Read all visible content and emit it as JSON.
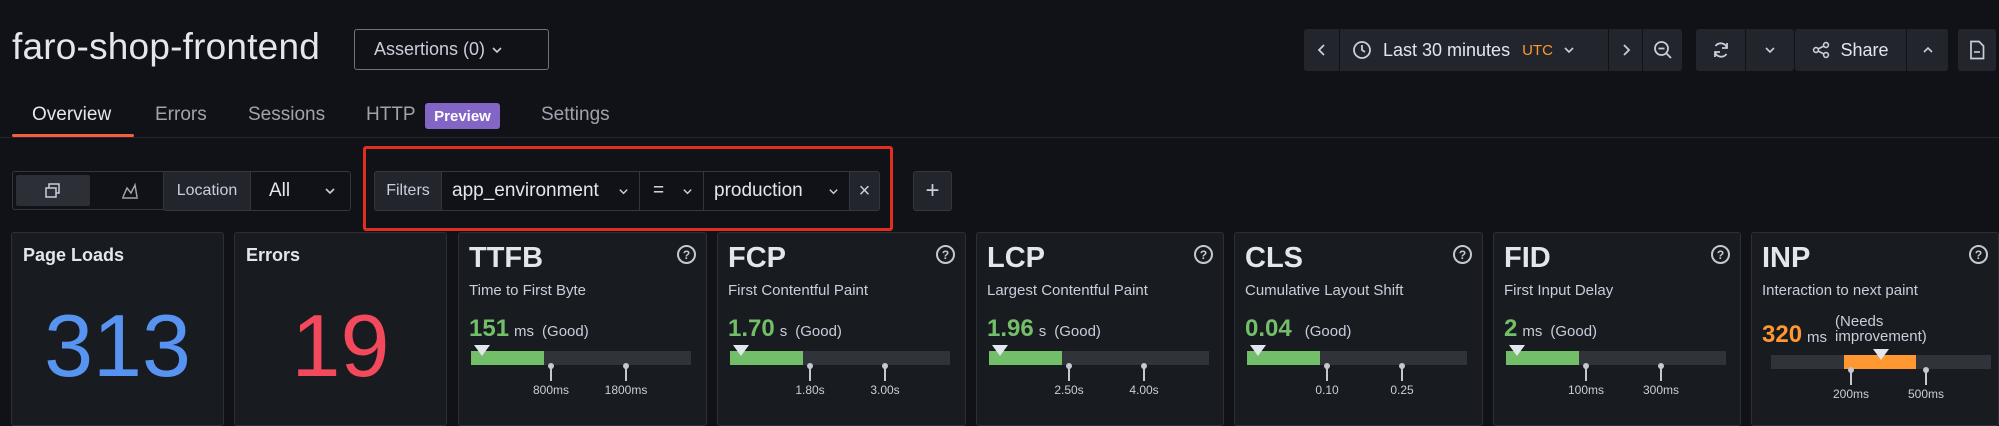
{
  "app": {
    "title": "faro-shop-frontend",
    "assertions_label": "Assertions (0)"
  },
  "toolbar": {
    "time_range": "Last 30 minutes",
    "timezone": "UTC",
    "share_label": "Share"
  },
  "tabs": [
    {
      "label": "Overview",
      "active": true
    },
    {
      "label": "Errors",
      "active": false
    },
    {
      "label": "Sessions",
      "active": false
    },
    {
      "label": "HTTP",
      "active": false,
      "badge": "Preview"
    },
    {
      "label": "Settings",
      "active": false
    }
  ],
  "location": {
    "label": "Location",
    "value": "All"
  },
  "filters": {
    "label": "Filters",
    "key": "app_environment",
    "operator": "=",
    "value": "production",
    "remove_glyph": "×",
    "add_glyph": "+"
  },
  "stats": [
    {
      "title": "Page Loads",
      "value": "313",
      "color": "#5794f2"
    },
    {
      "title": "Errors",
      "value": "19",
      "color": "#f2495c"
    }
  ],
  "vitals": [
    {
      "abbr": "TTFB",
      "name": "Time to First Byte",
      "value": "151",
      "unit": "ms",
      "rating": "(Good)",
      "rating_line2": "",
      "value_color": "#73bf69",
      "fill_color": "#73bf69",
      "fill_fraction": 0.33,
      "thresholds": [
        "800ms",
        "1800ms"
      ]
    },
    {
      "abbr": "FCP",
      "name": "First Contentful Paint",
      "value": "1.70",
      "unit": "s",
      "rating": "(Good)",
      "rating_line2": "",
      "value_color": "#73bf69",
      "fill_color": "#73bf69",
      "fill_fraction": 0.33,
      "thresholds": [
        "1.80s",
        "3.00s"
      ]
    },
    {
      "abbr": "LCP",
      "name": "Largest Contentful Paint",
      "value": "1.96",
      "unit": "s",
      "rating": "(Good)",
      "rating_line2": "",
      "value_color": "#73bf69",
      "fill_color": "#73bf69",
      "fill_fraction": 0.33,
      "thresholds": [
        "2.50s",
        "4.00s"
      ]
    },
    {
      "abbr": "CLS",
      "name": "Cumulative Layout Shift",
      "value": "0.04",
      "unit": "",
      "rating": "(Good)",
      "rating_line2": "",
      "value_color": "#73bf69",
      "fill_color": "#73bf69",
      "fill_fraction": 0.33,
      "thresholds": [
        "0.10",
        "0.25"
      ]
    },
    {
      "abbr": "FID",
      "name": "First Input Delay",
      "value": "2",
      "unit": "ms",
      "rating": "(Good)",
      "rating_line2": "",
      "value_color": "#73bf69",
      "fill_color": "#73bf69",
      "fill_fraction": 0.33,
      "thresholds": [
        "100ms",
        "300ms"
      ]
    },
    {
      "abbr": "INP",
      "name": "Interaction to next paint",
      "value": "320",
      "unit": "ms",
      "rating": "(Needs",
      "rating_line2": "improvement)",
      "value_color": "#ff9830",
      "fill_color": "#ff9830",
      "fill_fraction": 0.33,
      "thresholds": [
        "200ms",
        "500ms"
      ]
    }
  ],
  "icons": {
    "chevron_left": "chevron-left-icon",
    "clock": "clock-icon",
    "chevron_right": "chevron-right-icon",
    "zoom_out": "zoom-out-icon",
    "refresh": "refresh-icon",
    "share": "share-icon",
    "collapse": "chevron-up-icon",
    "export": "file-export-icon"
  }
}
